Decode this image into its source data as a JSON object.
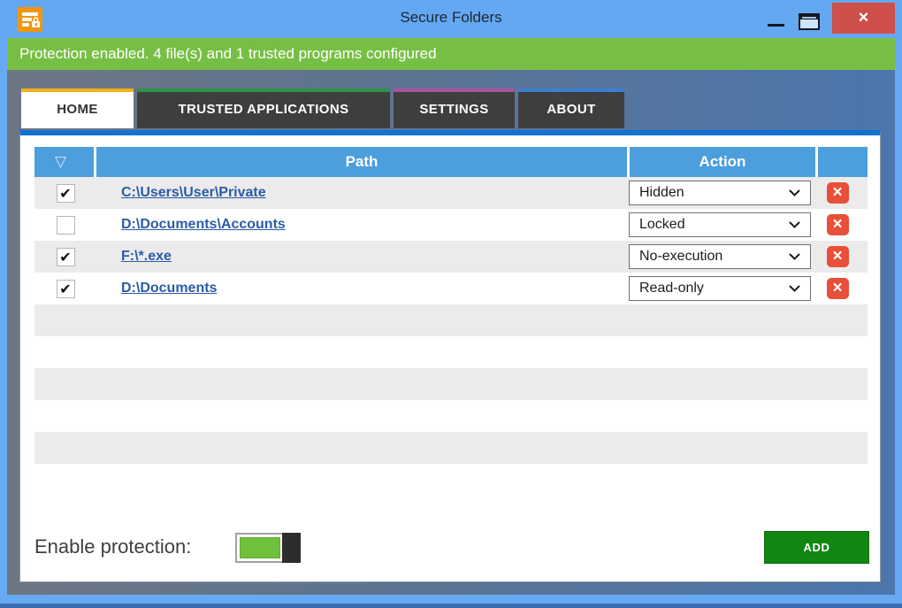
{
  "window": {
    "title": "Secure Folders",
    "close_glyph": "×"
  },
  "status_bar": {
    "text": "Protection enabled. 4 file(s) and 1 trusted programs configured"
  },
  "tabs": [
    {
      "label": "HOME",
      "active": true
    },
    {
      "label": "TRUSTED APPLICATIONS",
      "active": false
    },
    {
      "label": "SETTINGS",
      "active": false
    },
    {
      "label": "ABOUT",
      "active": false
    }
  ],
  "table": {
    "filter_icon_glyph": "▽",
    "path_header": "Path",
    "action_header": "Action",
    "delete_glyph": "×",
    "rows": [
      {
        "check": "✔",
        "path": "C:\\Users\\User\\Private",
        "action": "Hidden"
      },
      {
        "check": "",
        "path": "D:\\Documents\\Accounts",
        "action": "Locked"
      },
      {
        "check": "✔",
        "path": "F:\\*.exe",
        "action": "No-execution"
      },
      {
        "check": "✔",
        "path": "D:\\Documents",
        "action": "Read-only"
      }
    ],
    "empty_row_count": 6
  },
  "footer": {
    "enable_label": "Enable protection:",
    "toggle_state": "on",
    "add_label": "ADD"
  },
  "colors": {
    "title_bar": "#64a8f2",
    "status_green": "#77bf44",
    "header_blue": "#4d9edd",
    "panel_accent": "#1272d2",
    "tab_accent_home": "#f2b01e",
    "tab_accent_trusted": "#2e9149",
    "tab_accent_settings": "#a8529e",
    "tab_accent_about": "#3d7ed0",
    "delete_red": "#e8503a",
    "add_green": "#118611",
    "toggle_green": "#6fc13c",
    "link_blue": "#2b5ca8"
  }
}
